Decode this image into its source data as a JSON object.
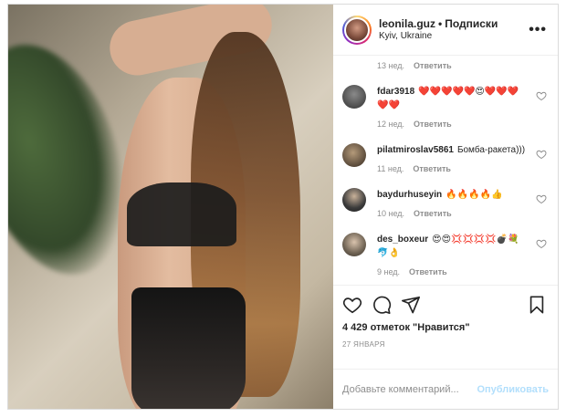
{
  "post": {
    "author": "leonila.guz",
    "separator": "•",
    "follow_label": "Подписки",
    "location": "Kyiv, Ukraine",
    "more_icon": "more-horizontal-icon",
    "likes_text": "4 429 отметок \"Нравится\"",
    "date": "27 ЯНВАРЯ"
  },
  "first_meta": {
    "time": "13 нед.",
    "reply": "Ответить"
  },
  "comments": [
    {
      "user": "fdar3918",
      "text": "❤️❤️❤️❤️❤️😍❤️❤️❤️❤️❤️",
      "time": "12 нед.",
      "reply": "Ответить"
    },
    {
      "user": "pilatmiroslav5861",
      "text": "Бомба-ракета)))",
      "time": "11 нед.",
      "reply": "Ответить"
    },
    {
      "user": "baydurhuseyin",
      "text": "🔥🔥🔥🔥👍",
      "time": "10 нед.",
      "reply": "Ответить"
    },
    {
      "user": "des_boxeur",
      "text": "😍😍💢💢💢💢💣💐🐬👌",
      "time": "9 нед.",
      "reply": "Ответить"
    }
  ],
  "actions": {
    "like_icon": "heart-icon",
    "comment_icon": "comment-icon",
    "share_icon": "share-icon",
    "save_icon": "bookmark-icon"
  },
  "add_comment": {
    "placeholder": "Добавьте комментарий...",
    "publish_label": "Опубликовать"
  },
  "colors": {
    "publish_disabled": "#b2dffc",
    "muted_text": "#8e8e8e",
    "border": "#dbdbdb"
  }
}
